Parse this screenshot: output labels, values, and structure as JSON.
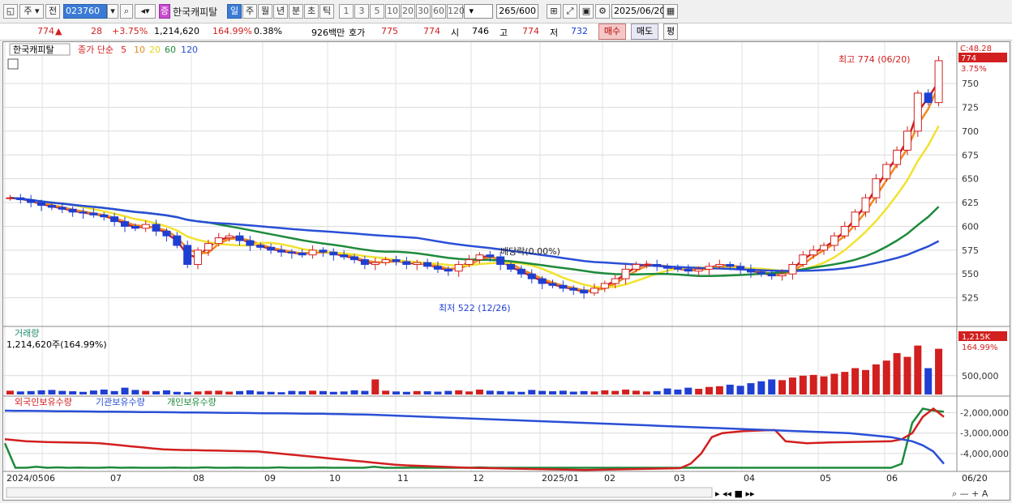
{
  "toolbar": {
    "market_label": "주",
    "prev_label": "전",
    "stock_code": "023760",
    "stock_badge": "증",
    "stock_name": "한국캐피탈",
    "period_day": "일",
    "period_week": "주",
    "period_month": "월",
    "period_year": "년",
    "period_minute": "분",
    "period_second": "초",
    "period_tick": "틱",
    "intervals": [
      "1",
      "3",
      "5",
      "10",
      "20",
      "30",
      "60",
      "120"
    ],
    "count": "265",
    "count_total": "/600",
    "date": "2025/06/20"
  },
  "status": {
    "price": "774",
    "change_arrow": "▲",
    "change": "28",
    "change_pct": "+3.75%",
    "volume": "1,214,620",
    "volume_pct": "164.99%",
    "turnover": "0.38%",
    "amount": "926백만",
    "quote_label": "호가",
    "ask": "775",
    "bid": "774",
    "open_label": "시",
    "open": "746",
    "high_label": "고",
    "high": "774",
    "low_label": "저",
    "low": "732",
    "buy_button": "매수",
    "sell_button": "매도",
    "eval_button": "평"
  },
  "legend": {
    "name": "한국캐피탈",
    "ma_label": "종가 단순",
    "ma": [
      "5",
      "10",
      "20",
      "60",
      "120"
    ],
    "volume_title": "거래량",
    "volume_value": "1,214,620주(164.99%)",
    "holdings": [
      "외국인보유수량",
      "기관보유수량",
      "개인보유수량"
    ]
  },
  "annotations": {
    "high_text": "최고 774 (06/20)",
    "low_text": "최저 522 (12/26)",
    "dividend_text": "배당락(0.00%)",
    "price_tag": "774",
    "price_tag_pct": "3.75%",
    "scale_top": "C:48.28",
    "vol_tag": "1,215K",
    "vol_tag_pct": "164.99%"
  },
  "chart_data": {
    "type": "candlestick",
    "x_axis": [
      "2024/05",
      "06",
      "07",
      "08",
      "09",
      "10",
      "11",
      "12",
      "2025/01",
      "02",
      "03",
      "04",
      "05",
      "06",
      "06/20"
    ],
    "price_ticks": [
      750,
      725,
      700,
      675,
      650,
      625,
      600,
      575,
      550,
      525
    ],
    "volume_ticks": [
      "500,000"
    ],
    "holdings_ticks": [
      "-2,000,000",
      "-3,000,000",
      "-4,000,000"
    ],
    "closes": [
      630,
      628,
      625,
      622,
      620,
      618,
      615,
      614,
      612,
      610,
      605,
      600,
      598,
      602,
      595,
      590,
      580,
      560,
      575,
      582,
      588,
      590,
      585,
      580,
      578,
      575,
      573,
      572,
      570,
      575,
      573,
      570,
      568,
      565,
      560,
      562,
      565,
      563,
      560,
      562,
      558,
      555,
      553,
      560,
      565,
      570,
      568,
      560,
      555,
      550,
      545,
      540,
      538,
      535,
      533,
      530,
      535,
      540,
      545,
      555,
      560,
      560,
      558,
      556,
      555,
      553,
      555,
      558,
      560,
      558,
      555,
      552,
      550,
      548,
      550,
      560,
      570,
      575,
      580,
      590,
      600,
      615,
      630,
      650,
      665,
      680,
      700,
      740,
      730,
      774
    ],
    "volume_series": [
      100,
      80,
      90,
      110,
      120,
      95,
      85,
      70,
      105,
      130,
      90,
      180,
      120,
      95,
      85,
      110,
      70,
      60,
      80,
      95,
      100,
      75,
      90,
      110,
      80,
      70,
      60,
      95,
      85,
      100,
      90,
      70,
      80,
      110,
      95,
      400,
      100,
      80,
      70,
      90,
      85,
      75,
      95,
      110,
      80,
      130,
      100,
      90,
      80,
      70,
      120,
      95,
      85,
      100,
      75,
      90,
      80,
      110,
      95,
      130,
      100,
      80,
      90,
      160,
      130,
      180,
      150,
      200,
      220,
      260,
      230,
      300,
      350,
      400,
      380,
      450,
      500,
      520,
      480,
      550,
      600,
      700,
      650,
      800,
      900,
      1100,
      1000,
      1300,
      700,
      1215
    ],
    "foreign_holdings": [
      -1900000,
      -1905000,
      -1910000,
      -1915000,
      -1920000,
      -1925000,
      -1930000,
      -1935000,
      -1940000,
      -1945000,
      -1950000,
      -1955000,
      -1960000,
      -1965000,
      -1970000,
      -1975000,
      -1980000,
      -1985000,
      -1990000,
      -1995000,
      -2000000,
      -2005000,
      -2010000,
      -2015000,
      -2020000,
      -2025000,
      -2030000,
      -2035000,
      -2040000,
      -2045000,
      -2050000,
      -2060000,
      -2070000,
      -2080000,
      -2090000,
      -2100000,
      -2120000,
      -2140000,
      -2160000,
      -2180000,
      -2200000,
      -2220000,
      -2240000,
      -2260000,
      -2280000,
      -2300000,
      -2320000,
      -2340000,
      -2360000,
      -2380000,
      -2400000,
      -2420000,
      -2440000,
      -2460000,
      -2480000,
      -2500000,
      -2520000,
      -2540000,
      -2560000,
      -2580000,
      -2600000,
      -2620000,
      -2640000,
      -2660000,
      -2680000,
      -2700000,
      -2720000,
      -2740000,
      -2760000,
      -2780000,
      -2800000,
      -2820000,
      -2840000,
      -2860000,
      -2880000,
      -2900000,
      -2920000,
      -2940000,
      -2960000,
      -2980000,
      -3000000,
      -3050000,
      -3100000,
      -3150000,
      -3200000,
      -3300000,
      -3400000,
      -3600000,
      -3900000,
      -4500000
    ],
    "institution_holdings": [
      -3300000,
      -3350000,
      -3400000,
      -3420000,
      -3440000,
      -3450000,
      -3460000,
      -3470000,
      -3480000,
      -3500000,
      -3550000,
      -3600000,
      -3650000,
      -3700000,
      -3750000,
      -3800000,
      -3820000,
      -3830000,
      -3840000,
      -3850000,
      -3860000,
      -3870000,
      -3880000,
      -3890000,
      -3900000,
      -3950000,
      -4000000,
      -4050000,
      -4100000,
      -4150000,
      -4200000,
      -4250000,
      -4300000,
      -4350000,
      -4400000,
      -4450000,
      -4500000,
      -4550000,
      -4580000,
      -4600000,
      -4620000,
      -4640000,
      -4660000,
      -4680000,
      -4700000,
      -4710000,
      -4720000,
      -4730000,
      -4740000,
      -4750000,
      -4760000,
      -4770000,
      -4780000,
      -4790000,
      -4800000,
      -4810000,
      -4800000,
      -4790000,
      -4780000,
      -4770000,
      -4760000,
      -4750000,
      -4740000,
      -4730000,
      -4720000,
      -4500000,
      -4000000,
      -3200000,
      -3000000,
      -2950000,
      -2900000,
      -2880000,
      -2860000,
      -2850000,
      -3400000,
      -3450000,
      -3500000,
      -3480000,
      -3460000,
      -3450000,
      -3440000,
      -3430000,
      -3420000,
      -3410000,
      -3400000,
      -3300000,
      -3000000,
      -2200000,
      -1800000,
      -2200000
    ],
    "individual_holdings": [
      -3500000,
      -4700000,
      -4700000,
      -4650000,
      -4700000,
      -4680000,
      -4700000,
      -4690000,
      -4700000,
      -4700000,
      -4680000,
      -4700000,
      -4690000,
      -4700000,
      -4700000,
      -4700000,
      -4690000,
      -4700000,
      -4700000,
      -4680000,
      -4700000,
      -4700000,
      -4690000,
      -4700000,
      -4700000,
      -4700000,
      -4680000,
      -4700000,
      -4700000,
      -4700000,
      -4690000,
      -4700000,
      -4700000,
      -4700000,
      -4700000,
      -4650000,
      -4700000,
      -4700000,
      -4700000,
      -4690000,
      -4700000,
      -4700000,
      -4700000,
      -4700000,
      -4700000,
      -4680000,
      -4700000,
      -4700000,
      -4700000,
      -4700000,
      -4700000,
      -4700000,
      -4700000,
      -4700000,
      -4700000,
      -4700000,
      -4700000,
      -4700000,
      -4700000,
      -4700000,
      -4700000,
      -4700000,
      -4700000,
      -4700000,
      -4700000,
      -4700000,
      -4700000,
      -4700000,
      -4700000,
      -4700000,
      -4700000,
      -4700000,
      -4700000,
      -4700000,
      -4700000,
      -4700000,
      -4700000,
      -4700000,
      -4700000,
      -4700000,
      -4700000,
      -4700000,
      -4700000,
      -4700000,
      -4700000,
      -4500000,
      -2500000,
      -1800000,
      -1900000,
      -1950000
    ]
  }
}
